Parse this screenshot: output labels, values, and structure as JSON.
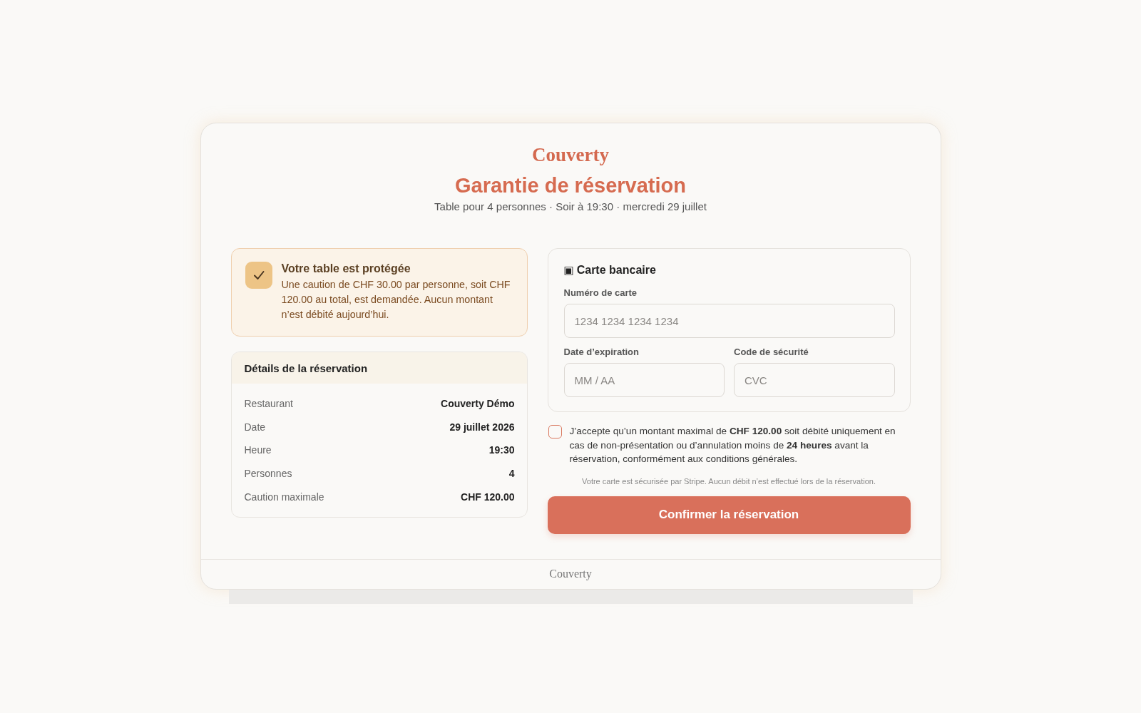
{
  "brand": "Couverty",
  "title": "Garantie de réservation",
  "subtitle": "Table pour 4 personnes · Soir à 19:30 · mercredi 29 juillet",
  "notice": {
    "title": "Votre table est protégée",
    "text": "Une caution de CHF 30.00 par personne, soit CHF 120.00 au total, est demandée. Aucun montant n’est débité aujourd’hui."
  },
  "details": {
    "title": "Détails de la réservation",
    "rows": [
      {
        "label": "Restaurant",
        "value": "Couverty Démo"
      },
      {
        "label": "Date",
        "value": "29 juillet 2026"
      },
      {
        "label": "Heure",
        "value": "19:30"
      },
      {
        "label": "Personnes",
        "value": "4"
      },
      {
        "label": "Caution maximale",
        "value": "CHF 120.00"
      }
    ]
  },
  "payment": {
    "icon": "▣",
    "title": "Carte bancaire",
    "card_number": {
      "label": "Numéro de carte",
      "placeholder": "1234 1234 1234 1234"
    },
    "expiry": {
      "label": "Date d’expiration",
      "placeholder": "MM / AA"
    },
    "security_code": {
      "label": "Code de sécurité",
      "placeholder": "CVC"
    }
  },
  "consent": {
    "checked": false,
    "text": "J’accepte qu’un montant maximal de **CHF 120.00** soit débité uniquement en cas de non-présentation ou d’annulation moins de **24 heures** avant la réservation, conformément aux conditions générales."
  },
  "security_note": "Votre carte est sécurisée par Stripe. Aucun débit n’est effectué lors de la réservation.",
  "submit_button": "Confirmer la réservation",
  "footer": "Couverty"
}
